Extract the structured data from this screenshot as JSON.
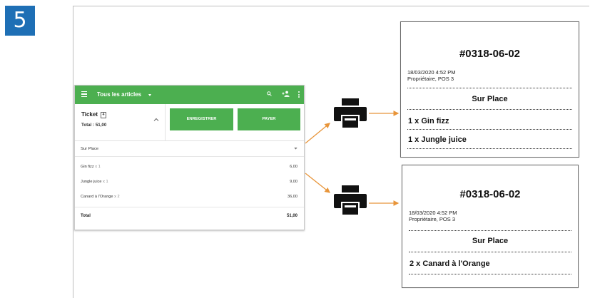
{
  "step": {
    "number": "5"
  },
  "pos": {
    "toolbar": {
      "title": "Tous les articles",
      "color": "#4caf50",
      "icons": [
        "menu-icon",
        "search-icon",
        "add-user-icon",
        "more-vert-icon"
      ]
    },
    "ticket": {
      "label": "Ticket",
      "count": "4",
      "total": "Total : 51,00"
    },
    "buttons": {
      "save": "ENREGISTRER",
      "pay": "PAYER"
    },
    "dining_option": "Sur Place",
    "items": [
      {
        "name": "Gin fizz",
        "qty": "x 1",
        "price": "6,00"
      },
      {
        "name": "Jungle juice",
        "qty": "x 1",
        "price": "9,00"
      },
      {
        "name": "Canard à l'Orange",
        "qty": "x 2",
        "price": "36,00"
      }
    ],
    "total": {
      "label": "Total",
      "value": "51,00"
    }
  },
  "receipts": [
    {
      "number": "#0318-06-02",
      "datetime": "18/03/2020 4:52 PM",
      "owner": "Propriétaire, POS 3",
      "dining": "Sur Place",
      "lines": [
        "1 x Gin fizz",
        "1 x Jungle juice"
      ]
    },
    {
      "number": "#0318-06-02",
      "datetime": "18/03/2020 4:52 PM",
      "owner": "Propriétaire, POS 3",
      "dining": "Sur Place",
      "lines": [
        "2 x Canard à l'Orange"
      ]
    }
  ],
  "colors": {
    "accent": "#4caf50",
    "badge": "#1e6fb5",
    "arrow": "#e8953a"
  }
}
